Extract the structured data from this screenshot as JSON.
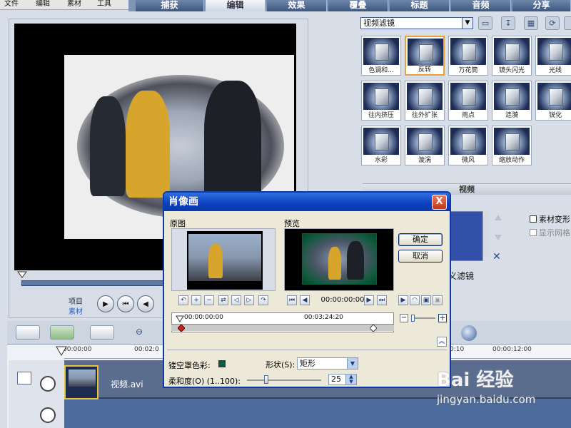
{
  "menu": [
    "文件",
    "编辑",
    "素材",
    "工具"
  ],
  "tabs": [
    {
      "label": "捕获",
      "active": false
    },
    {
      "label": "编辑",
      "active": true
    },
    {
      "label": "效果",
      "active": false
    },
    {
      "label": "覆叠",
      "active": false
    },
    {
      "label": "标题",
      "active": false
    },
    {
      "label": "音频",
      "active": false
    },
    {
      "label": "分享",
      "active": false
    }
  ],
  "preview": {
    "mode_project": "项目",
    "mode_clip": "素材"
  },
  "filter_panel": {
    "category": "视频滤镜",
    "filters": [
      {
        "label": "色调和...",
        "selected": false
      },
      {
        "label": "反转",
        "selected": true
      },
      {
        "label": "万花筒",
        "selected": false
      },
      {
        "label": "镜头闪光",
        "selected": false
      },
      {
        "label": "光线",
        "selected": false
      },
      {
        "label": "往内挤压",
        "selected": false
      },
      {
        "label": "往外扩张",
        "selected": false
      },
      {
        "label": "雨点",
        "selected": false
      },
      {
        "label": "涟漪",
        "selected": false
      },
      {
        "label": "锐化",
        "selected": false
      },
      {
        "label": "水彩",
        "selected": false
      },
      {
        "label": "漩涡",
        "selected": false
      },
      {
        "label": "微风",
        "selected": false
      },
      {
        "label": "缩放动作",
        "selected": false
      }
    ],
    "section_header": "视频",
    "option_deform": "素材变形",
    "option_grid": "显示网格",
    "custom_filter": "义滤镜"
  },
  "timeline": {
    "ticks": [
      "00:00:00",
      "00:02:0",
      "0:10",
      "00:00:12:00"
    ],
    "clip_name": "视频.avi"
  },
  "dialog": {
    "title": "肖像画",
    "close": "X",
    "original_label": "原图",
    "preview_label": "预览",
    "ok": "确定",
    "cancel": "取消",
    "timecode": "00:00:00:00",
    "tl_start": "00:00:00:00",
    "tl_end": "00:03:24:20",
    "mask_color_label": "镂空罩色彩:",
    "mask_color": "#0d5a44",
    "shape_label": "形状(S):",
    "shape_value": "矩形",
    "softness_label": "柔和度(O) (1..100):",
    "softness_value": "25"
  },
  "watermark": {
    "logo": "Bai 经验",
    "url": "jingyan.baidu.com"
  }
}
